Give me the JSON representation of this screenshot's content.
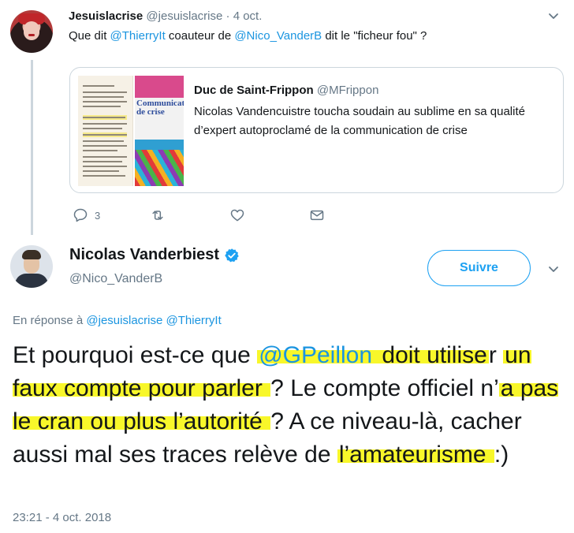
{
  "thread": {
    "parent": {
      "author_name": "Jesuislacrise",
      "author_handle": "@jesuislacrise",
      "separator": "·",
      "date": "4 oct.",
      "text_prefix": "Que dit ",
      "mention1": "@ThierryIt",
      "text_middle": " coauteur de ",
      "mention2": "@Nico_VanderB",
      "text_suffix": " dit le \"ficheur fou\" ?"
    },
    "quote": {
      "author_name": "Duc de Saint-Frippon",
      "author_handle": "@MFrippon",
      "text": "Nicolas Vandencuistre toucha soudain au sublime en sa qualité d’expert autoproclamé de la communication de crise",
      "book_title": "Communication de crise"
    },
    "actions": {
      "reply_count": "3",
      "reply_icon": "reply-icon",
      "retweet_icon": "retweet-icon",
      "like_icon": "heart-icon",
      "dm_icon": "mail-icon"
    }
  },
  "main": {
    "author_name": "Nicolas Vanderbiest",
    "author_handle": "@Nico_VanderB",
    "follow_label": "Suivre",
    "reply_prefix": "En réponse à ",
    "reply_mention1": "@jesuislacrise",
    "reply_mention2": "@ThierryIt",
    "text": {
      "p1": "Et pourquoi est-ce que ",
      "mention": "@GPeillon",
      "h1": " doit utilise",
      "p2": "r ",
      "h2": "un faux compte pour parler ",
      "p3": "? Le compte officiel n’",
      "h3": "a pas le cran ou plus l’autorité ",
      "p4": "? A ce niveau-là, cacher aussi mal ses traces relève de ",
      "h4": "l’amateurisme ",
      "p5": ":)"
    },
    "timestamp": "23:21 - 4 oct. 2018"
  },
  "colors": {
    "link": "#1b95e0",
    "follow": "#1da1f2",
    "highlight": "#f8f72a",
    "muted": "#657786"
  }
}
